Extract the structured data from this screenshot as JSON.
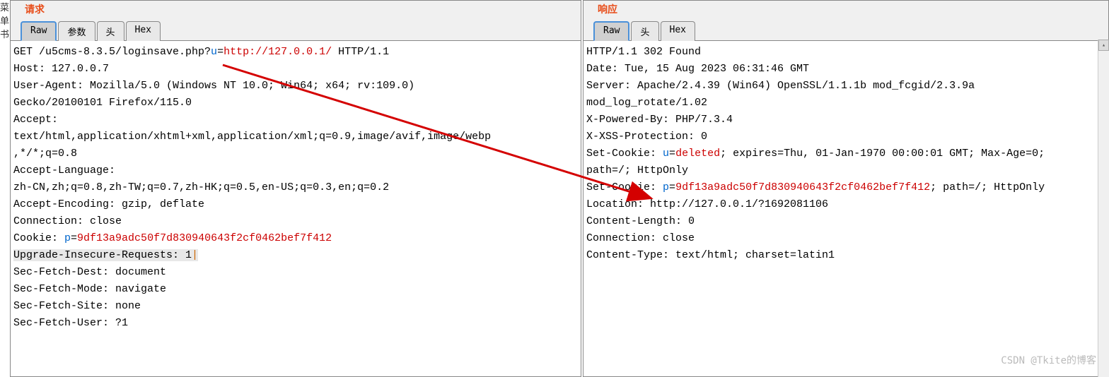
{
  "sidebar_chars": "菜单书",
  "request": {
    "title": "请求",
    "tabs": [
      "Raw",
      "参数",
      "头",
      "Hex"
    ],
    "active_tab": 0,
    "line1_a": "GET /u5cms-8.3.5/loginsave.php?",
    "line1_b": "u",
    "line1_c": "=",
    "line1_d": "http://127.0.0.1/",
    "line1_e": " HTTP/1.1",
    "host": "Host: 127.0.0.7",
    "ua1": "User-Agent: Mozilla/5.0 (Windows NT 10.0; Win64; x64; rv:109.0)",
    "ua2": "Gecko/20100101 Firefox/115.0",
    "accept_lbl": "Accept:",
    "accept_val1": "text/html,application/xhtml+xml,application/xml;q=0.9,image/avif,image/webp",
    "accept_val2": ",*/*;q=0.8",
    "acc_lang_lbl": "Accept-Language:",
    "acc_lang_val": "zh-CN,zh;q=0.8,zh-TW;q=0.7,zh-HK;q=0.5,en-US;q=0.3,en;q=0.2",
    "acc_enc": "Accept-Encoding: gzip, deflate",
    "conn": "Connection: close",
    "cookie_a": "Cookie: ",
    "cookie_b": "p",
    "cookie_c": "=",
    "cookie_d": "9df13a9adc50f7d830940643f2cf0462bef7f412",
    "upgrade": "Upgrade-Insecure-Requests: 1",
    "cursor": "|",
    "sf_dest": "Sec-Fetch-Dest: document",
    "sf_mode": "Sec-Fetch-Mode: navigate",
    "sf_site": "Sec-Fetch-Site: none",
    "sf_user": "Sec-Fetch-User: ?1"
  },
  "response": {
    "title": "响应",
    "tabs": [
      "Raw",
      "头",
      "Hex"
    ],
    "active_tab": 0,
    "status": "HTTP/1.1 302 Found",
    "date": "Date: Tue, 15 Aug 2023 06:31:46 GMT",
    "server1": "Server: Apache/2.4.39 (Win64) OpenSSL/1.1.1b mod_fcgid/2.3.9a",
    "server2": "mod_log_rotate/1.02",
    "xpb": "X-Powered-By: PHP/7.3.4",
    "xss": "X-XSS-Protection: 0",
    "sc1_a": "Set-Cookie: ",
    "sc1_b": "u",
    "sc1_c": "=",
    "sc1_d": "deleted",
    "sc1_e": "; expires=Thu, 01-Jan-1970 00:00:01 GMT; Max-Age=0;",
    "sc1_f": "path=/; HttpOnly",
    "sc2_a": "Set-Cookie: ",
    "sc2_b": "p",
    "sc2_c": "=",
    "sc2_d": "9df13a9adc50f7d830940643f2cf0462bef7f412",
    "sc2_e": "; path=/; HttpOnly",
    "loc": "Location: http://127.0.0.1/?1692081106",
    "clen": "Content-Length: 0",
    "conn": "Connection: close",
    "ctype": "Content-Type: text/html; charset=latin1"
  },
  "watermark": "CSDN @Tkite的博客"
}
